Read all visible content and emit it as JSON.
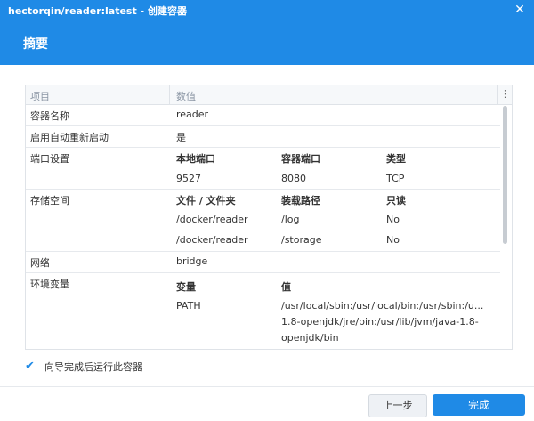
{
  "window": {
    "title": "hectorqin/reader:latest - 创建容器",
    "close_glyph": "✕"
  },
  "section_title": "摘要",
  "table": {
    "headers": {
      "item": "项目",
      "value": "数值",
      "menu_glyph": "⋮"
    },
    "rows": {
      "container_name": {
        "label": "容器名称",
        "value": "reader"
      },
      "auto_restart": {
        "label": "启用自动重新启动",
        "value": "是"
      },
      "ports": {
        "label": "端口设置",
        "headers": [
          "本地端口",
          "容器端口",
          "类型"
        ],
        "rows": [
          [
            "9527",
            "8080",
            "TCP"
          ]
        ]
      },
      "storage": {
        "label": "存储空间",
        "headers": [
          "文件 / 文件夹",
          "装载路径",
          "只读"
        ],
        "rows": [
          [
            "/docker/reader",
            "/log",
            "No"
          ],
          [
            "/docker/reader",
            "/storage",
            "No"
          ]
        ]
      },
      "network": {
        "label": "网络",
        "value": "bridge"
      },
      "env": {
        "label": "环境变量",
        "headers": [
          "变量",
          "值"
        ],
        "var": "PATH",
        "value_lines": [
          "/usr/local/sbin:/usr/local/bin:/usr/sbin:/u...",
          "1.8-openjdk/jre/bin:/usr/lib/jvm/java-1.8-",
          "openjdk/bin"
        ]
      }
    }
  },
  "footer": {
    "run_after_wizard": {
      "checked": true,
      "label": "向导完成后运行此容器"
    },
    "prev_button": "上一步",
    "done_button": "完成"
  },
  "colors": {
    "accent": "#1f8ae6",
    "border": "#dfe3e8",
    "header_bg": "#f6f8fa"
  }
}
